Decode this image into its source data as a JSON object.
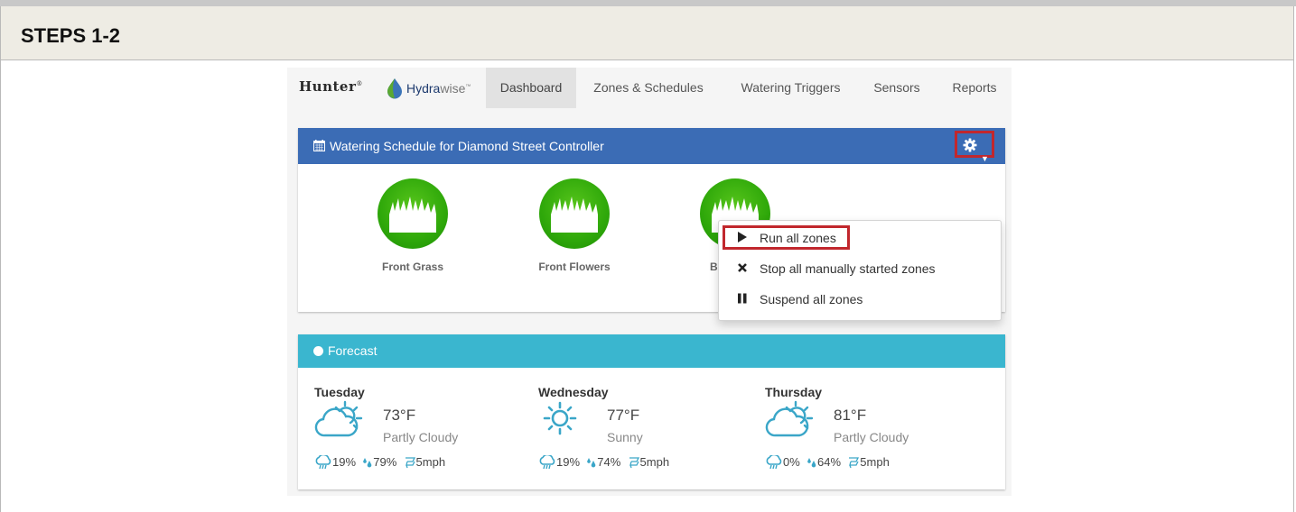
{
  "steps": {
    "title": "STEPS 1-2"
  },
  "nav": {
    "brand": "Hunter",
    "brand_mark": "®",
    "logo_hydra": "Hydra",
    "logo_wise": "wise",
    "logo_tm": "™",
    "items": [
      {
        "label": "Dashboard",
        "active": true
      },
      {
        "label": "Zones & Schedules"
      },
      {
        "label": "Watering Triggers"
      },
      {
        "label": "Sensors"
      },
      {
        "label": "Reports"
      }
    ]
  },
  "schedule": {
    "title": "Watering Schedule for Diamond Street Controller",
    "zones": [
      {
        "name": "Front Grass"
      },
      {
        "name": "Front Flowers"
      },
      {
        "name": "Back Drip"
      }
    ],
    "menu": [
      {
        "label": "Run all zones",
        "icon": "play-icon"
      },
      {
        "label": "Stop all manually started zones",
        "icon": "close-icon"
      },
      {
        "label": "Suspend all zones",
        "icon": "pause-icon"
      }
    ]
  },
  "forecast": {
    "title": "Forecast",
    "days": [
      {
        "day": "Tuesday",
        "temp": "73°F",
        "condition": "Partly Cloudy",
        "icon": "partly-cloudy-icon",
        "rain": "19%",
        "humidity": "79%",
        "wind": "5mph"
      },
      {
        "day": "Wednesday",
        "temp": "77°F",
        "condition": "Sunny",
        "icon": "sunny-icon",
        "rain": "19%",
        "humidity": "74%",
        "wind": "5mph"
      },
      {
        "day": "Thursday",
        "temp": "81°F",
        "condition": "Partly Cloudy",
        "icon": "partly-cloudy-icon",
        "rain": "0%",
        "humidity": "64%",
        "wind": "5mph"
      }
    ]
  },
  "colors": {
    "schedule_header": "#3b6cb5",
    "forecast_header": "#3ab6cf",
    "highlight": "#c1272d",
    "zone_green": "#2fa80a",
    "weather_icon": "#3aa6c8"
  }
}
